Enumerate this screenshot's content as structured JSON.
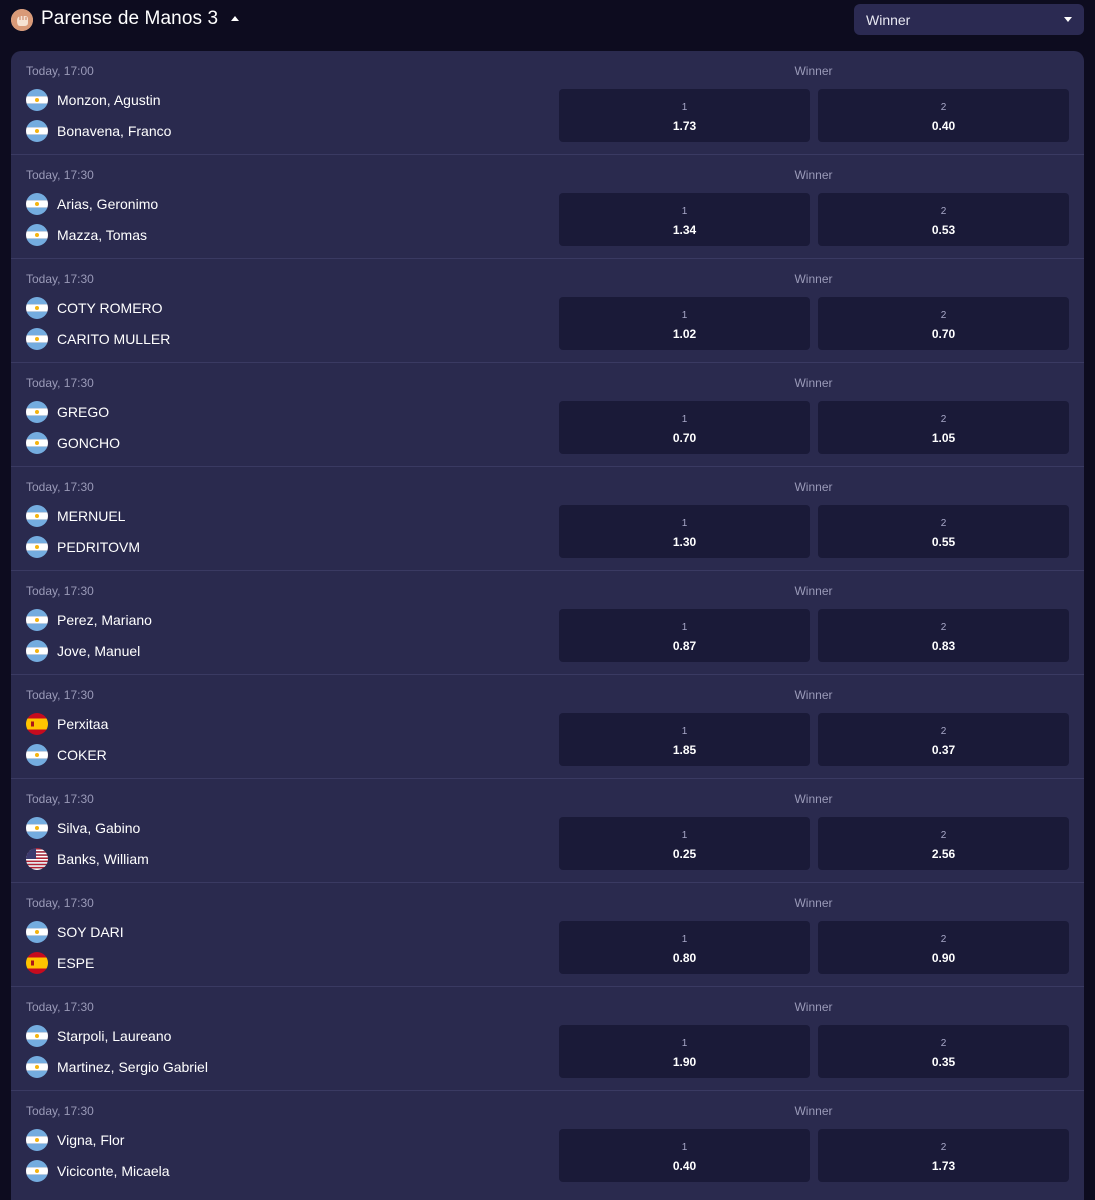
{
  "header": {
    "league_title": "Parense de Manos 3",
    "market_select": "Winner",
    "league_icon": "fist-icon"
  },
  "colors": {
    "background": "#0d0c1f",
    "card": "#2a2a4e",
    "odds_button": "#1a1a38",
    "select": "#2b2a52",
    "muted_text": "#9a9ab8"
  },
  "events": [
    {
      "time": "Today, 17:00",
      "market": "Winner",
      "team1": {
        "name": "Monzon, Agustin",
        "flag": "argentina-flag-icon"
      },
      "team2": {
        "name": "Bonavena, Franco",
        "flag": "argentina-flag-icon"
      },
      "odds": [
        {
          "label": "1",
          "value": "1.73"
        },
        {
          "label": "2",
          "value": "0.40"
        }
      ]
    },
    {
      "time": "Today, 17:30",
      "market": "Winner",
      "team1": {
        "name": "Arias, Geronimo",
        "flag": "argentina-flag-icon"
      },
      "team2": {
        "name": "Mazza, Tomas",
        "flag": "argentina-flag-icon"
      },
      "odds": [
        {
          "label": "1",
          "value": "1.34"
        },
        {
          "label": "2",
          "value": "0.53"
        }
      ]
    },
    {
      "time": "Today, 17:30",
      "market": "Winner",
      "team1": {
        "name": "COTY ROMERO",
        "flag": "argentina-flag-icon"
      },
      "team2": {
        "name": "CARITO MULLER",
        "flag": "argentina-flag-icon"
      },
      "odds": [
        {
          "label": "1",
          "value": "1.02"
        },
        {
          "label": "2",
          "value": "0.70"
        }
      ]
    },
    {
      "time": "Today, 17:30",
      "market": "Winner",
      "team1": {
        "name": "GREGO",
        "flag": "argentina-flag-icon"
      },
      "team2": {
        "name": "GONCHO",
        "flag": "argentina-flag-icon"
      },
      "odds": [
        {
          "label": "1",
          "value": "0.70"
        },
        {
          "label": "2",
          "value": "1.05"
        }
      ]
    },
    {
      "time": "Today, 17:30",
      "market": "Winner",
      "team1": {
        "name": "MERNUEL",
        "flag": "argentina-flag-icon"
      },
      "team2": {
        "name": "PEDRITOVM",
        "flag": "argentina-flag-icon"
      },
      "odds": [
        {
          "label": "1",
          "value": "1.30"
        },
        {
          "label": "2",
          "value": "0.55"
        }
      ]
    },
    {
      "time": "Today, 17:30",
      "market": "Winner",
      "team1": {
        "name": "Perez, Mariano",
        "flag": "argentina-flag-icon"
      },
      "team2": {
        "name": "Jove, Manuel",
        "flag": "argentina-flag-icon"
      },
      "odds": [
        {
          "label": "1",
          "value": "0.87"
        },
        {
          "label": "2",
          "value": "0.83"
        }
      ]
    },
    {
      "time": "Today, 17:30",
      "market": "Winner",
      "team1": {
        "name": "Perxitaa",
        "flag": "spain-flag-icon"
      },
      "team2": {
        "name": "COKER",
        "flag": "argentina-flag-icon"
      },
      "odds": [
        {
          "label": "1",
          "value": "1.85"
        },
        {
          "label": "2",
          "value": "0.37"
        }
      ]
    },
    {
      "time": "Today, 17:30",
      "market": "Winner",
      "team1": {
        "name": "Silva, Gabino",
        "flag": "argentina-flag-icon"
      },
      "team2": {
        "name": "Banks, William",
        "flag": "usa-flag-icon"
      },
      "odds": [
        {
          "label": "1",
          "value": "0.25"
        },
        {
          "label": "2",
          "value": "2.56"
        }
      ]
    },
    {
      "time": "Today, 17:30",
      "market": "Winner",
      "team1": {
        "name": "SOY DARI",
        "flag": "argentina-flag-icon"
      },
      "team2": {
        "name": "ESPE",
        "flag": "spain-flag-icon"
      },
      "odds": [
        {
          "label": "1",
          "value": "0.80"
        },
        {
          "label": "2",
          "value": "0.90"
        }
      ]
    },
    {
      "time": "Today, 17:30",
      "market": "Winner",
      "team1": {
        "name": "Starpoli, Laureano",
        "flag": "argentina-flag-icon"
      },
      "team2": {
        "name": "Martinez, Sergio Gabriel",
        "flag": "argentina-flag-icon"
      },
      "odds": [
        {
          "label": "1",
          "value": "1.90"
        },
        {
          "label": "2",
          "value": "0.35"
        }
      ]
    },
    {
      "time": "Today, 17:30",
      "market": "Winner",
      "team1": {
        "name": "Vigna, Flor",
        "flag": "argentina-flag-icon"
      },
      "team2": {
        "name": "Viciconte, Micaela",
        "flag": "argentina-flag-icon"
      },
      "odds": [
        {
          "label": "1",
          "value": "0.40"
        },
        {
          "label": "2",
          "value": "1.73"
        }
      ]
    }
  ]
}
